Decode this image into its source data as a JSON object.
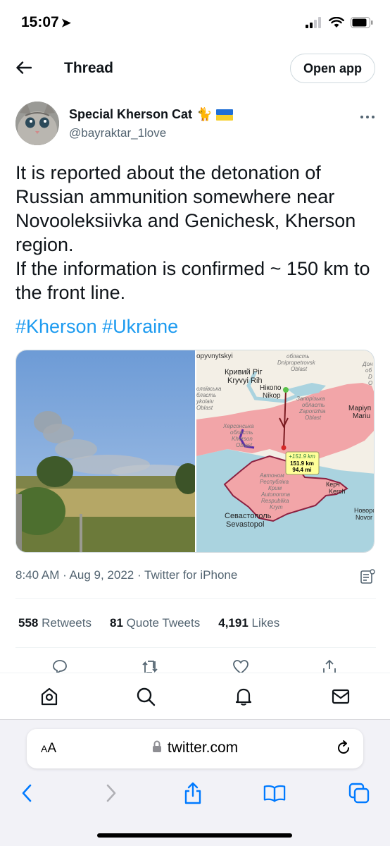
{
  "status_bar": {
    "time": "15:07",
    "location_glyph": "➤"
  },
  "header": {
    "title": "Thread",
    "open_app_label": "Open app"
  },
  "author": {
    "name": "Special Kherson Cat",
    "emoji": "🐈",
    "handle": "@bayraktar_1love"
  },
  "tweet": {
    "text": "It is reported about the detonation of Russian ammunition somewhere near Novooleksiivka and Genichesk, Kherson region.\nIf the information is confirmed ~ 150 km to the front line.",
    "hashtags": "#Kherson #Ukraine"
  },
  "media": {
    "map_labels": {
      "kropyvnytskyi": "opyvnytskyi",
      "oblast_top": "область",
      "dnipro": "Dnipropetrovsk",
      "oblast_top2": "Oblast",
      "don": "Дон",
      "don2": "об",
      "don3": "D",
      "don4": "O",
      "kryvyi_ua": "Кривий Ріг",
      "kryvyi": "Kryvyi Rih",
      "nikopol_ua": "Нікопо",
      "nikopol": "Nikop",
      "mykolaiv1": "олаївська",
      "mykolaiv2": "бласть",
      "mykolaiv3": "ykolaiv",
      "mykolaiv4": "Oblast",
      "zap_ua": "Запорізька",
      "zap_ua2": "область",
      "zap": "Zaporizhia",
      "zap2": "Oblast",
      "mariu_ua": "Маріуп",
      "mariu": "Mariu",
      "kherson_ua": "Херсонська",
      "kherson_ua2": "область",
      "kherson": "Kherson",
      "kherson2": "Oblast",
      "distance_top": "+151.9 km",
      "distance_km": "151.9 km",
      "distance_mi": "94.4 mi",
      "crimea_ua": "Автоном",
      "crimea_ua2": "Республіка",
      "crimea_ua3": "Крим",
      "crimea": "Autonomna",
      "crimea2": "Respublika",
      "crimea3": "Krym",
      "kerch_ua": "Керч",
      "kerch": "Kerch",
      "sevast_ua": "Севастополь",
      "sevast": "Sevastopol",
      "novoros_ua": "Новорс",
      "novoros": "Novor"
    }
  },
  "meta": {
    "timestamp": "8:40 AM · Aug 9, 2022 · Twitter for iPhone"
  },
  "stats": {
    "retweets_count": "558",
    "retweets_label": "Retweets",
    "quotes_count": "81",
    "quotes_label": "Quote Tweets",
    "likes_count": "4,191",
    "likes_label": "Likes"
  },
  "safari": {
    "aa_label": "AA",
    "url": "twitter.com"
  },
  "colors": {
    "link": "#1d9bf0",
    "secondary_text": "#536471",
    "safari_blue": "#007aff",
    "occupied": "#f2a5a8"
  }
}
